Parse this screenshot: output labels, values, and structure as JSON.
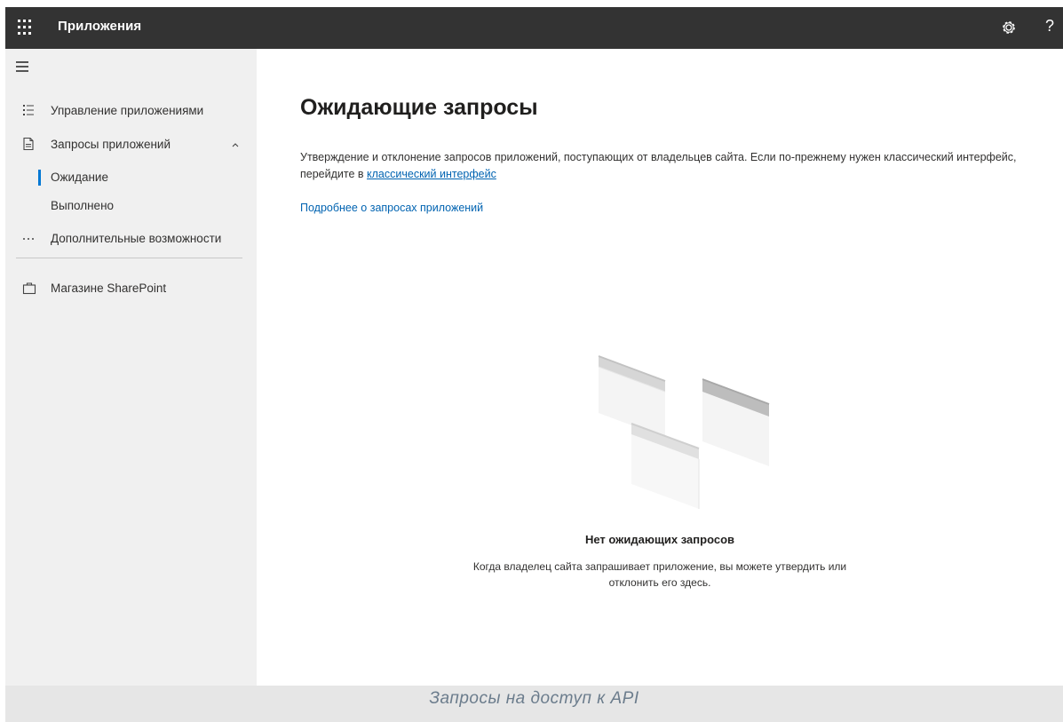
{
  "topbar": {
    "app_launcher_icon": "waffle-icon",
    "title": "Приложения",
    "settings_icon": "gear-icon",
    "help_label": "?"
  },
  "sidebar": {
    "menu_icon": "hamburger-icon",
    "items": [
      {
        "label": "Управление приложениями",
        "icon": "list-icon"
      },
      {
        "label": "Запросы приложений",
        "icon": "document-icon",
        "expanded": true
      },
      {
        "label": "Ожидание",
        "selected": true
      },
      {
        "label": "Выполнено"
      },
      {
        "label": "Дополнительные возможности",
        "icon": "more-icon"
      },
      {
        "label": "Магазине SharePoint",
        "icon": "shopping-bag-icon"
      }
    ],
    "accent": "#0078d4"
  },
  "main": {
    "title": "Ожидающие запросы",
    "description_prefix": "Утверждение и отклонение запросов приложений, поступающих от владельцев сайта. Если по-прежнему нужен классический интерфейс, перейдите в ",
    "classic_link": "классический интерфейс",
    "learn_more": "Подробнее о запросах приложений",
    "empty_state": {
      "title": "Нет ожидающих запросов",
      "line1": "Когда владелец сайта запрашивает приложение, вы можете утвердить или",
      "line2": "отклонить его здесь."
    }
  },
  "caption": "Запросы на доступ к API",
  "colors": {
    "topbar": "#333333",
    "sidebar": "#f0f0f0",
    "link": "#0063b1"
  }
}
